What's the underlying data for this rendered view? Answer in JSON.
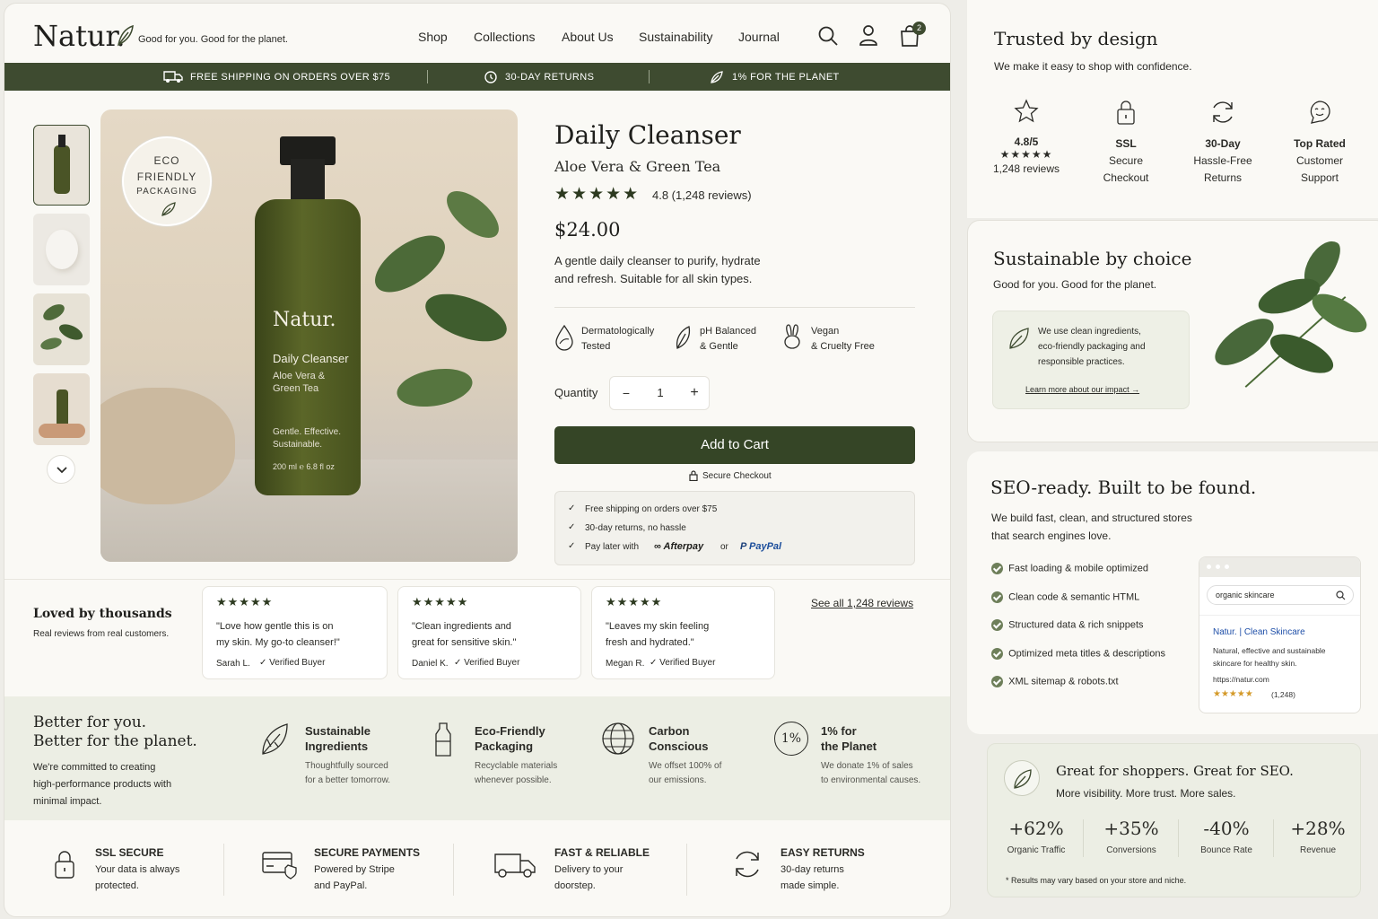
{
  "brand": {
    "logo": "Natur.",
    "tagline": "Good for you. Good for the planet."
  },
  "nav": [
    "Shop",
    "Collections",
    "About Us",
    "Sustainability",
    "Journal"
  ],
  "cart_count": "2",
  "promo": [
    "FREE SHIPPING ON ORDERS OVER $75",
    "30-DAY RETURNS",
    "1% FOR THE PLANET"
  ],
  "badge": {
    "l1": "ECO",
    "l2": "FRIENDLY",
    "l3": "PACKAGING"
  },
  "bottle": {
    "brand": "Natur.",
    "name": "Daily Cleanser",
    "l1": "Aloe Vera &",
    "l2": "Green Tea",
    "t1": "Gentle. Effective.",
    "t2": "Sustainable.",
    "vol": "200 ml  ℮ 6.8 fl oz"
  },
  "product": {
    "title": "Daily Cleanser",
    "subtitle": "Aloe Vera & Green Tea",
    "stars": "★★★★★",
    "rating": "4.8 (1,248 reviews)",
    "price": "$24.00",
    "desc1": "A gentle daily cleanser to purify, hydrate",
    "desc2": "and refresh. Suitable for all skin types.",
    "features": [
      {
        "a": "Dermatologically",
        "b": "Tested"
      },
      {
        "a": "pH Balanced",
        "b": "& Gentle"
      },
      {
        "a": "Vegan",
        "b": "& Cruelty Free"
      }
    ],
    "qty_label": "Quantity",
    "qty": "1",
    "minus": "−",
    "plus": "+",
    "add": "Add to Cart",
    "secure": "Secure Checkout",
    "perks": [
      "Free shipping on orders over $75",
      "30-day returns, no hassle"
    ],
    "paylater": "Pay later with",
    "afterpay": "Afterpay",
    "or": "or",
    "paypal": "PayPal"
  },
  "reviews": {
    "title": "Loved by thousands",
    "sub": "Real reviews from real customers.",
    "see_all": "See all 1,248 reviews",
    "stars": "★★★★★",
    "items": [
      {
        "l1": "\"Love how gentle this is on",
        "l2": "my skin. My go-to cleanser!\"",
        "name": "Sarah L.",
        "verified": "Verified Buyer"
      },
      {
        "l1": "\"Clean ingredients and",
        "l2": "great for sensitive skin.\"",
        "name": "Daniel K.",
        "verified": "Verified Buyer"
      },
      {
        "l1": "\"Leaves my skin feeling",
        "l2": "fresh and hydrated.\"",
        "name": "Megan R.",
        "verified": "Verified Buyer"
      }
    ]
  },
  "better": {
    "h1": "Better for you.",
    "h2": "Better for the planet.",
    "p1": "We're committed to creating",
    "p2": "high-performance products with",
    "p3": "minimal impact.",
    "items": [
      {
        "t1": "Sustainable",
        "t2": "Ingredients",
        "s1": "Thoughtfully sourced",
        "s2": "for a better tomorrow."
      },
      {
        "t1": "Eco-Friendly",
        "t2": "Packaging",
        "s1": "Recyclable materials",
        "s2": "whenever possible."
      },
      {
        "t1": "Carbon",
        "t2": "Conscious",
        "s1": "We offset 100% of",
        "s2": "our emissions."
      },
      {
        "t1": "1% for",
        "t2": "the Planet",
        "s1": "We donate 1% of sales",
        "s2": "to environmental causes."
      }
    ],
    "one_pct": "1%"
  },
  "trust_bar": [
    {
      "t": "SSL SECURE",
      "s1": "Your data is always",
      "s2": "protected."
    },
    {
      "t": "SECURE PAYMENTS",
      "s1": "Powered by Stripe",
      "s2": "and PayPal."
    },
    {
      "t": "FAST & RELIABLE",
      "s1": "Delivery to your",
      "s2": "doorstep."
    },
    {
      "t": "EASY RETURNS",
      "s1": "30-day returns",
      "s2": "made simple."
    }
  ],
  "trusted": {
    "title": "Trusted by design",
    "sub": "We make it easy to shop with confidence.",
    "items": [
      {
        "a": "4.8/5",
        "b": "★★★★★",
        "c": "1,248 reviews"
      },
      {
        "a": "SSL",
        "b": "Secure",
        "c": "Checkout"
      },
      {
        "a": "30-Day",
        "b": "Hassle-Free",
        "c": "Returns"
      },
      {
        "a": "Top Rated",
        "b": "Customer",
        "c": "Support"
      }
    ]
  },
  "sustainable": {
    "title": "Sustainable by choice",
    "sub": "Good for you. Good for the planet.",
    "b1": "We use clean ingredients,",
    "b2": "eco-friendly packaging and",
    "b3": "responsible practices.",
    "link": "Learn more about our impact →"
  },
  "seo": {
    "title": "SEO-ready. Built to be found.",
    "p1": "We build fast, clean, and structured stores",
    "p2": "that search engines love.",
    "items": [
      "Fast loading & mobile optimized",
      "Clean code & semantic HTML",
      "Structured data & rich snippets",
      "Optimized meta titles & descriptions",
      "XML sitemap & robots.txt"
    ],
    "search": "organic skincare",
    "result_title": "Natur. | Clean Skincare",
    "r1": "Natural, effective and sustainable",
    "r2": "skincare for healthy skin.",
    "url": "https://natur.com",
    "rstars": "★★★★★",
    "rcount": "(1,248)"
  },
  "great": {
    "title": "Great for shoppers. Great for SEO.",
    "sub": "More visibility. More trust. More sales.",
    "stats": [
      {
        "v": "+62%",
        "l": "Organic Traffic"
      },
      {
        "v": "+35%",
        "l": "Conversions"
      },
      {
        "v": "-40%",
        "l": "Bounce Rate"
      },
      {
        "v": "+28%",
        "l": "Revenue"
      }
    ],
    "note": "* Results may vary based on your store and niche."
  }
}
